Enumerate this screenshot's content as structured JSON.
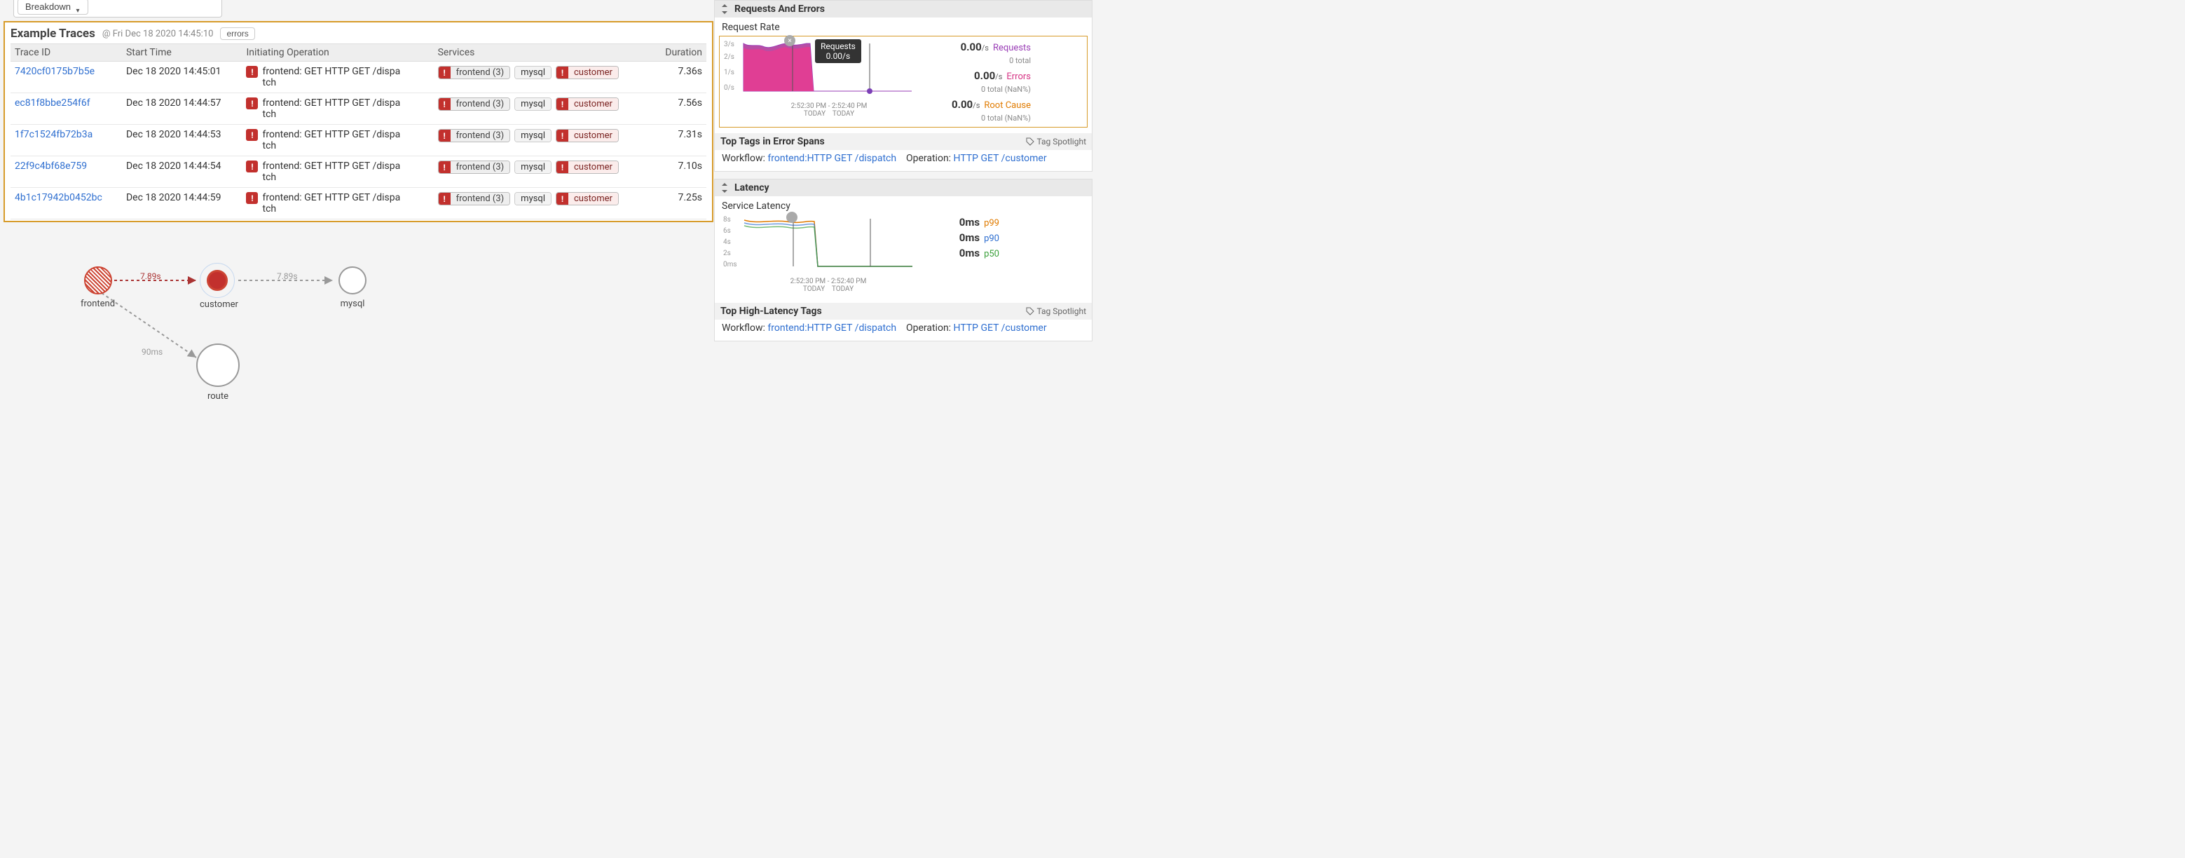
{
  "breakdown": {
    "label": "Breakdown"
  },
  "traces": {
    "title": "Example Traces",
    "timestamp": "@ Fri Dec 18 2020 14:45:10",
    "filter_label": "errors",
    "columns": [
      "Trace ID",
      "Start Time",
      "Initiating Operation",
      "Services",
      "Duration"
    ],
    "rows": [
      {
        "id": "7420cf0175b7b5e",
        "time": "Dec 18 2020 14:45:01",
        "op": "frontend: GET HTTP GET /dispatch",
        "svc_front": "frontend (3)",
        "svc_mysql": "mysql",
        "svc_cust": "customer",
        "dur": "7.36s"
      },
      {
        "id": "ec81f8bbe254f6f",
        "time": "Dec 18 2020 14:44:57",
        "op": "frontend: GET HTTP GET /dispatch",
        "svc_front": "frontend (3)",
        "svc_mysql": "mysql",
        "svc_cust": "customer",
        "dur": "7.56s"
      },
      {
        "id": "1f7c1524fb72b3a",
        "time": "Dec 18 2020 14:44:53",
        "op": "frontend: GET HTTP GET /dispatch",
        "svc_front": "frontend (3)",
        "svc_mysql": "mysql",
        "svc_cust": "customer",
        "dur": "7.31s"
      },
      {
        "id": "22f9c4bf68e759",
        "time": "Dec 18 2020 14:44:54",
        "op": "frontend: GET HTTP GET /dispatch",
        "svc_front": "frontend (3)",
        "svc_mysql": "mysql",
        "svc_cust": "customer",
        "dur": "7.10s"
      },
      {
        "id": "4b1c17942b0452bc",
        "time": "Dec 18 2020 14:44:59",
        "op": "frontend: GET HTTP GET /dispatch",
        "svc_front": "frontend (3)",
        "svc_mysql": "mysql",
        "svc_cust": "customer",
        "dur": "7.25s"
      }
    ]
  },
  "map": {
    "frontend": "frontend",
    "customer": "customer",
    "mysql": "mysql",
    "route": "route",
    "edge1": "7.89s",
    "edge2": "7.89s",
    "edge3": "90ms"
  },
  "requests_panel": {
    "header": "Requests And Errors",
    "subheader": "Request Rate",
    "yticks": [
      "3/s",
      "2/s",
      "1/s",
      "0/s"
    ],
    "tooltip_title": "Requests",
    "tooltip_value": "0.00/s",
    "xticks_left": "2:52:30 PM",
    "xticks_right": "2:52:40 PM",
    "xticks_sub": "TODAY",
    "legend": {
      "requests_val": "0.00",
      "requests_unit": "/s",
      "requests_name": "Requests",
      "requests_sub": "0  total",
      "errors_val": "0.00",
      "errors_unit": "/s",
      "errors_name": "Errors",
      "errors_sub": "0  total (NaN%)",
      "root_val": "0.00",
      "root_unit": "/s",
      "root_name": "Root Cause",
      "root_sub": "0  total (NaN%)"
    },
    "tags_header": "Top Tags in Error Spans",
    "tag_spotlight": "Tag Spotlight",
    "workflow_label": "Workflow:",
    "workflow_link": "frontend:HTTP GET /dispatch",
    "operation_label": "Operation:",
    "operation_link": "HTTP GET /customer"
  },
  "latency_panel": {
    "header": "Latency",
    "subheader": "Service Latency",
    "yticks": [
      "8s",
      "6s",
      "4s",
      "2s",
      "0ms"
    ],
    "xticks_left": "2:52:30 PM",
    "xticks_right": "2:52:40 PM",
    "xticks_sub": "TODAY",
    "legend": {
      "p99_val": "0ms",
      "p99_name": "p99",
      "p90_val": "0ms",
      "p90_name": "p90",
      "p50_val": "0ms",
      "p50_name": "p50"
    },
    "tags_header": "Top High-Latency Tags",
    "tag_spotlight": "Tag Spotlight",
    "workflow_label": "Workflow:",
    "workflow_link": "frontend:HTTP GET /dispatch",
    "operation_label": "Operation:",
    "operation_link": "HTTP GET /customer"
  },
  "chart_data": [
    {
      "type": "area",
      "title": "Request Rate",
      "yticks": [
        0,
        1,
        2,
        3
      ],
      "ylabel": "/s",
      "x_range": [
        "2:52:30 PM",
        "2:52:40 PM"
      ],
      "series": [
        {
          "name": "Requests",
          "values": [
            3,
            2.8,
            3,
            2.9,
            3,
            2.7,
            3,
            0,
            0,
            0
          ]
        },
        {
          "name": "Errors",
          "values": [
            2.9,
            2.6,
            2.9,
            2.8,
            2.9,
            2.6,
            2.9,
            0,
            0,
            0
          ]
        }
      ],
      "cursor": {
        "x_fraction": 0.82,
        "tooltip": "Requests 0.00/s"
      }
    },
    {
      "type": "line",
      "title": "Service Latency",
      "yticks": [
        "0ms",
        "2s",
        "4s",
        "6s",
        "8s"
      ],
      "x_range": [
        "2:52:30 PM",
        "2:52:40 PM"
      ],
      "series": [
        {
          "name": "p99",
          "values": [
            8,
            7.8,
            8,
            7.9,
            8,
            7.8,
            0,
            0,
            0,
            0
          ]
        },
        {
          "name": "p90",
          "values": [
            7.6,
            7.5,
            7.7,
            7.6,
            7.7,
            7.5,
            0,
            0,
            0,
            0
          ]
        },
        {
          "name": "p50",
          "values": [
            7.4,
            7.3,
            7.5,
            7.4,
            7.5,
            7.3,
            0,
            0,
            0,
            0
          ]
        }
      ]
    }
  ]
}
